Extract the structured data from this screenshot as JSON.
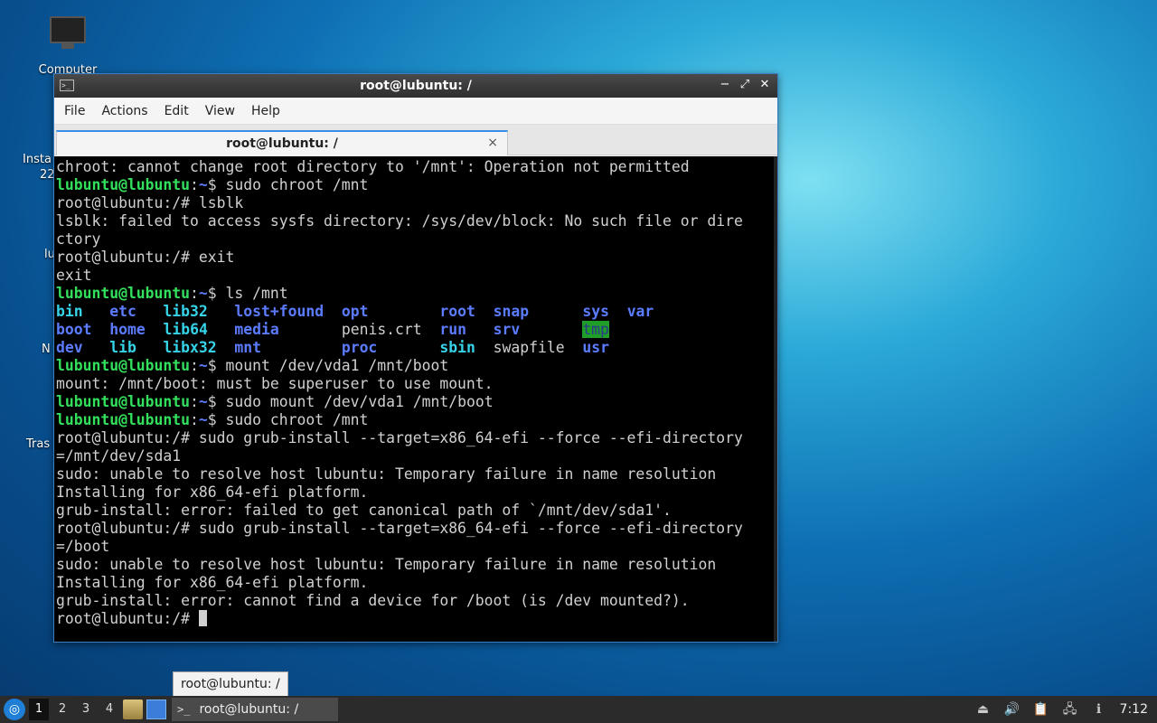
{
  "desktop": {
    "icons": [
      {
        "label": "Computer"
      }
    ],
    "partial_labels": [
      "Insta",
      "22",
      "lu",
      "N",
      "Tras"
    ]
  },
  "window": {
    "title": "root@lubuntu: /",
    "controls": {
      "minimize": "−",
      "maximize": "⤢",
      "close": "✕"
    },
    "menu": [
      "File",
      "Actions",
      "Edit",
      "View",
      "Help"
    ],
    "tab": {
      "label": "root@lubuntu: /",
      "close": "×"
    }
  },
  "terminal": {
    "lines": [
      [
        {
          "t": "chroot: cannot change root directory to '/mnt': Operation not permitted"
        }
      ],
      [
        {
          "t": "lubuntu@lubuntu",
          "c": "g"
        },
        {
          "t": ":"
        },
        {
          "t": "~",
          "c": "b"
        },
        {
          "t": "$ sudo chroot /mnt"
        }
      ],
      [
        {
          "t": "root@lubuntu:/# lsblk"
        }
      ],
      [
        {
          "t": "lsblk: failed to access sysfs directory: /sys/dev/block: No such file or dire"
        }
      ],
      [
        {
          "t": "ctory"
        }
      ],
      [
        {
          "t": "root@lubuntu:/# exit"
        }
      ],
      [
        {
          "t": "exit"
        }
      ],
      [
        {
          "t": "lubuntu@lubuntu",
          "c": "g"
        },
        {
          "t": ":"
        },
        {
          "t": "~",
          "c": "b"
        },
        {
          "t": "$ ls /mnt"
        }
      ],
      [
        {
          "t": "bin",
          "c": "c"
        },
        {
          "t": "   "
        },
        {
          "t": "etc",
          "c": "b"
        },
        {
          "t": "   "
        },
        {
          "t": "lib32",
          "c": "c"
        },
        {
          "t": "   "
        },
        {
          "t": "lost+found",
          "c": "b"
        },
        {
          "t": "  "
        },
        {
          "t": "opt",
          "c": "b"
        },
        {
          "t": "        "
        },
        {
          "t": "root",
          "c": "b"
        },
        {
          "t": "  "
        },
        {
          "t": "snap",
          "c": "b"
        },
        {
          "t": "      "
        },
        {
          "t": "sys",
          "c": "b"
        },
        {
          "t": "  "
        },
        {
          "t": "var",
          "c": "b"
        }
      ],
      [
        {
          "t": "boot",
          "c": "b"
        },
        {
          "t": "  "
        },
        {
          "t": "home",
          "c": "b"
        },
        {
          "t": "  "
        },
        {
          "t": "lib64",
          "c": "c"
        },
        {
          "t": "   "
        },
        {
          "t": "media",
          "c": "b"
        },
        {
          "t": "       "
        },
        {
          "t": "penis.crt"
        },
        {
          "t": "  "
        },
        {
          "t": "run",
          "c": "b"
        },
        {
          "t": "   "
        },
        {
          "t": "srv",
          "c": "b"
        },
        {
          "t": "       "
        },
        {
          "t": "tmp",
          "c": "hl"
        }
      ],
      [
        {
          "t": "dev",
          "c": "b"
        },
        {
          "t": "   "
        },
        {
          "t": "lib",
          "c": "c"
        },
        {
          "t": "   "
        },
        {
          "t": "libx32",
          "c": "c"
        },
        {
          "t": "  "
        },
        {
          "t": "mnt",
          "c": "b"
        },
        {
          "t": "         "
        },
        {
          "t": "proc",
          "c": "b"
        },
        {
          "t": "       "
        },
        {
          "t": "sbin",
          "c": "c"
        },
        {
          "t": "  "
        },
        {
          "t": "swapfile"
        },
        {
          "t": "  "
        },
        {
          "t": "usr",
          "c": "b"
        }
      ],
      [
        {
          "t": "lubuntu@lubuntu",
          "c": "g"
        },
        {
          "t": ":"
        },
        {
          "t": "~",
          "c": "b"
        },
        {
          "t": "$ mount /dev/vda1 /mnt/boot"
        }
      ],
      [
        {
          "t": "mount: /mnt/boot: must be superuser to use mount."
        }
      ],
      [
        {
          "t": "lubuntu@lubuntu",
          "c": "g"
        },
        {
          "t": ":"
        },
        {
          "t": "~",
          "c": "b"
        },
        {
          "t": "$ sudo mount /dev/vda1 /mnt/boot"
        }
      ],
      [
        {
          "t": "lubuntu@lubuntu",
          "c": "g"
        },
        {
          "t": ":"
        },
        {
          "t": "~",
          "c": "b"
        },
        {
          "t": "$ sudo chroot /mnt"
        }
      ],
      [
        {
          "t": "root@lubuntu:/# sudo grub-install --target=x86_64-efi --force --efi-directory"
        }
      ],
      [
        {
          "t": "=/mnt/dev/sda1"
        }
      ],
      [
        {
          "t": "sudo: unable to resolve host lubuntu: Temporary failure in name resolution"
        }
      ],
      [
        {
          "t": "Installing for x86_64-efi platform."
        }
      ],
      [
        {
          "t": "grub-install: error: failed to get canonical path of `/mnt/dev/sda1'."
        }
      ],
      [
        {
          "t": "root@lubuntu:/# sudo grub-install --target=x86_64-efi --force --efi-directory"
        }
      ],
      [
        {
          "t": "=/boot"
        }
      ],
      [
        {
          "t": "sudo: unable to resolve host lubuntu: Temporary failure in name resolution"
        }
      ],
      [
        {
          "t": "Installing for x86_64-efi platform."
        }
      ],
      [
        {
          "t": "grub-install: error: cannot find a device for /boot (is /dev mounted?)."
        }
      ],
      [
        {
          "t": "root@lubuntu:/# "
        }
      ]
    ]
  },
  "tooltip": "root@lubuntu: /",
  "taskbar": {
    "workspaces": [
      "1",
      "2",
      "3",
      "4"
    ],
    "active_workspace": "1",
    "task_label": "root@lubuntu: /",
    "clock": "7:12"
  },
  "colors": {
    "prompt_green": "#33e05c",
    "dir_blue": "#5c7cff",
    "link_cyan": "#36d4e8",
    "window_border": "#3a7fc4"
  }
}
